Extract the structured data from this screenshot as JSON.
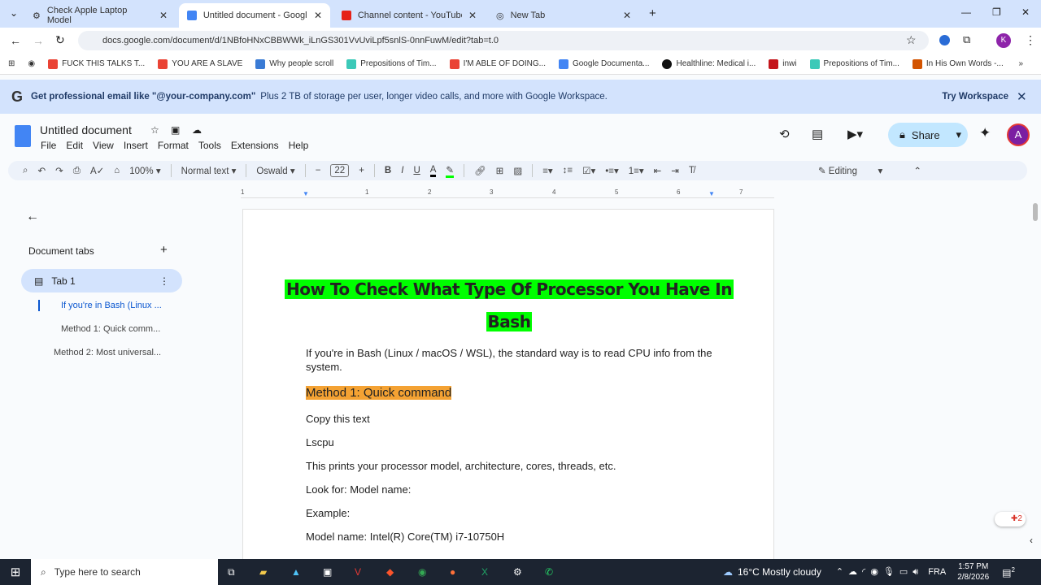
{
  "browser": {
    "tabs": [
      {
        "title": "Check Apple Laptop Model"
      },
      {
        "title": "Untitled document - Google Do"
      },
      {
        "title": "Channel content - YouTube Stu"
      },
      {
        "title": "New Tab"
      }
    ],
    "url": "docs.google.com/document/d/1NBfoHNxCBBWWk_iLnGS301VvUviLpf5snlS-0nnFuwM/edit?tab=t.0",
    "profile_initial": "K",
    "bookmarks": [
      "FUCK THIS TALKS T...",
      "YOU ARE A SLAVE",
      "Why people scroll",
      "Prepositions of Tim...",
      "I'M ABLE OF DOING...",
      "Google Documenta...",
      "Healthline: Medical i...",
      "inwi",
      "Prepositions of Tim...",
      "In His Own Words -..."
    ]
  },
  "banner": {
    "bold": "Get professional email like \"@your-company.com\"",
    "text": "Plus 2 TB of storage per user, longer video calls, and more with Google Workspace.",
    "action": "Try Workspace"
  },
  "docs": {
    "title": "Untitled document",
    "menu": [
      "File",
      "Edit",
      "View",
      "Insert",
      "Format",
      "Tools",
      "Extensions",
      "Help"
    ],
    "share": "Share",
    "avatar": "A",
    "toolbar": {
      "zoom": "100%",
      "style": "Normal text",
      "font": "Oswald",
      "size": "22",
      "mode": "Editing"
    },
    "ruler": [
      "1",
      "1",
      "2",
      "3",
      "4",
      "5",
      "6",
      "7"
    ]
  },
  "sidebar": {
    "heading": "Document tabs",
    "tab": "Tab 1",
    "outline": [
      "If you're in Bash (Linux ...",
      "Method 1: Quick comm...",
      "Method 2: Most universal..."
    ]
  },
  "content": {
    "title1": "How To Check What Type Of Processor You Have In",
    "title2": "Bash",
    "intro": "If you're in Bash (Linux / macOS / WSL), the standard way is to read CPU info from the system.",
    "h1": "Method 1: Quick command",
    "p": [
      "Copy this text",
      "Lscpu",
      "This prints your processor model, architecture, cores, threads, etc.",
      "Look for: Model name:",
      "Example:",
      "Model name: Intel(R) Core(TM) i7-10750H"
    ]
  },
  "taskbar": {
    "search": "Type here to search",
    "weather": "16°C  Mostly cloudy",
    "lang": "FRA",
    "time": "1:57 PM",
    "date": "2/8/2026",
    "notif": "2"
  },
  "colors": {
    "title_highlight": "#00ff00",
    "heading_highlight": "#f4a233",
    "accent": "#0b57d0"
  }
}
